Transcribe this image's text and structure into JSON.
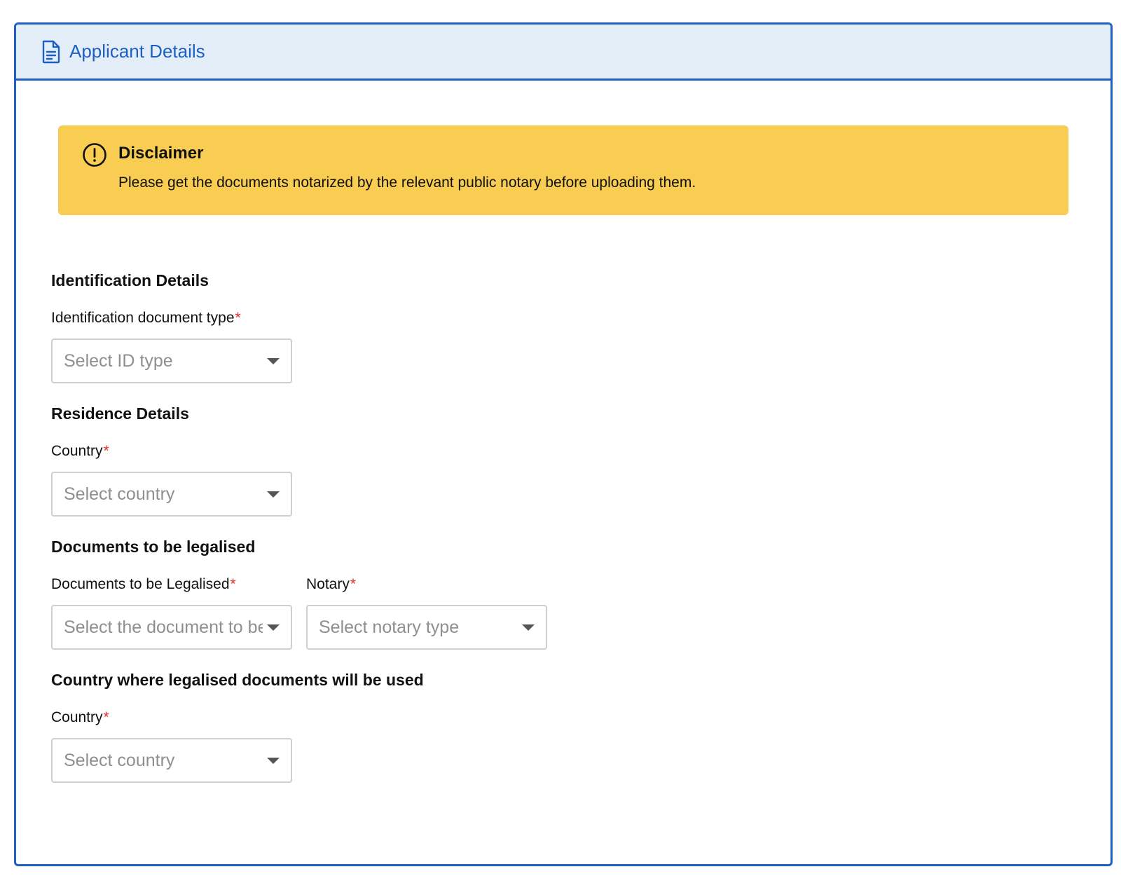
{
  "header": {
    "title": "Applicant Details",
    "icon": "document-icon",
    "accent_color": "#1f5fc2",
    "background_color": "#e4eef9"
  },
  "disclaimer": {
    "title": "Disclaimer",
    "text": "Please get the documents notarized by the relevant public notary before uploading them.",
    "icon": "exclamation-circle-icon",
    "background_color": "#f8cd51"
  },
  "identification": {
    "heading": "Identification Details",
    "id_type": {
      "label": "Identification document type",
      "required_mark": "*",
      "placeholder": "Select ID type"
    }
  },
  "residence": {
    "heading": "Residence Details",
    "country": {
      "label": "Country",
      "required_mark": "*",
      "placeholder": "Select country"
    }
  },
  "documents": {
    "heading": "Documents to be legalised",
    "document": {
      "label": "Documents to be Legalised",
      "required_mark": "*",
      "placeholder": "Select the document to be legalised"
    },
    "notary": {
      "label": "Notary",
      "required_mark": "*",
      "placeholder": "Select notary type"
    }
  },
  "destination": {
    "heading": "Country where legalised documents will be used",
    "country": {
      "label": "Country",
      "required_mark": "*",
      "placeholder": "Select country"
    }
  },
  "required_color": "#e0302b"
}
